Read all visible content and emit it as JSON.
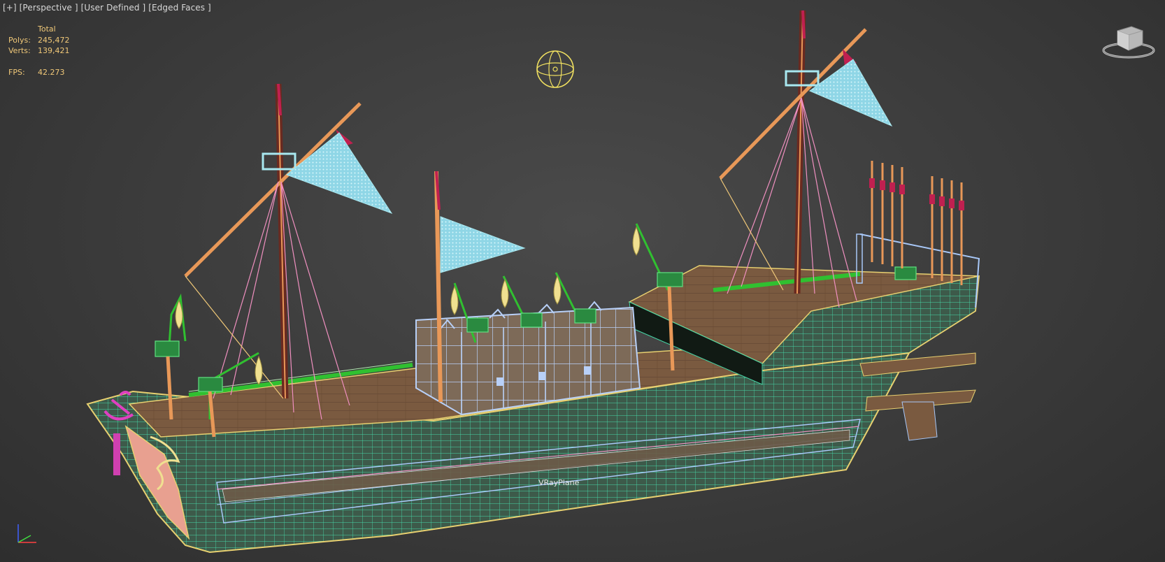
{
  "viewport": {
    "label_plus": "[+]",
    "label_view": "[Perspective ]",
    "label_shading": "[User Defined ]",
    "label_faces": "[Edged Faces ]"
  },
  "stats": {
    "header": "Total",
    "polys_label": "Polys:",
    "polys_value": "245,472",
    "verts_label": "Verts:",
    "verts_value": "139,421",
    "fps_label": "FPS:",
    "fps_value": "42.273"
  },
  "scene": {
    "object_label": "VRayPlane"
  },
  "colors": {
    "background": "#3b3b3b",
    "stats_text": "#f0c878",
    "hull_wire": "#46d8a8",
    "edge_highlight": "#e8d070",
    "mast": "#e89858",
    "sail": "#a8e8f0",
    "rope": "#f090c0",
    "deck": "#7a5a40",
    "cabin_wire": "#a8c8f8",
    "hook_green": "#30c030",
    "flag_red": "#c02050"
  }
}
